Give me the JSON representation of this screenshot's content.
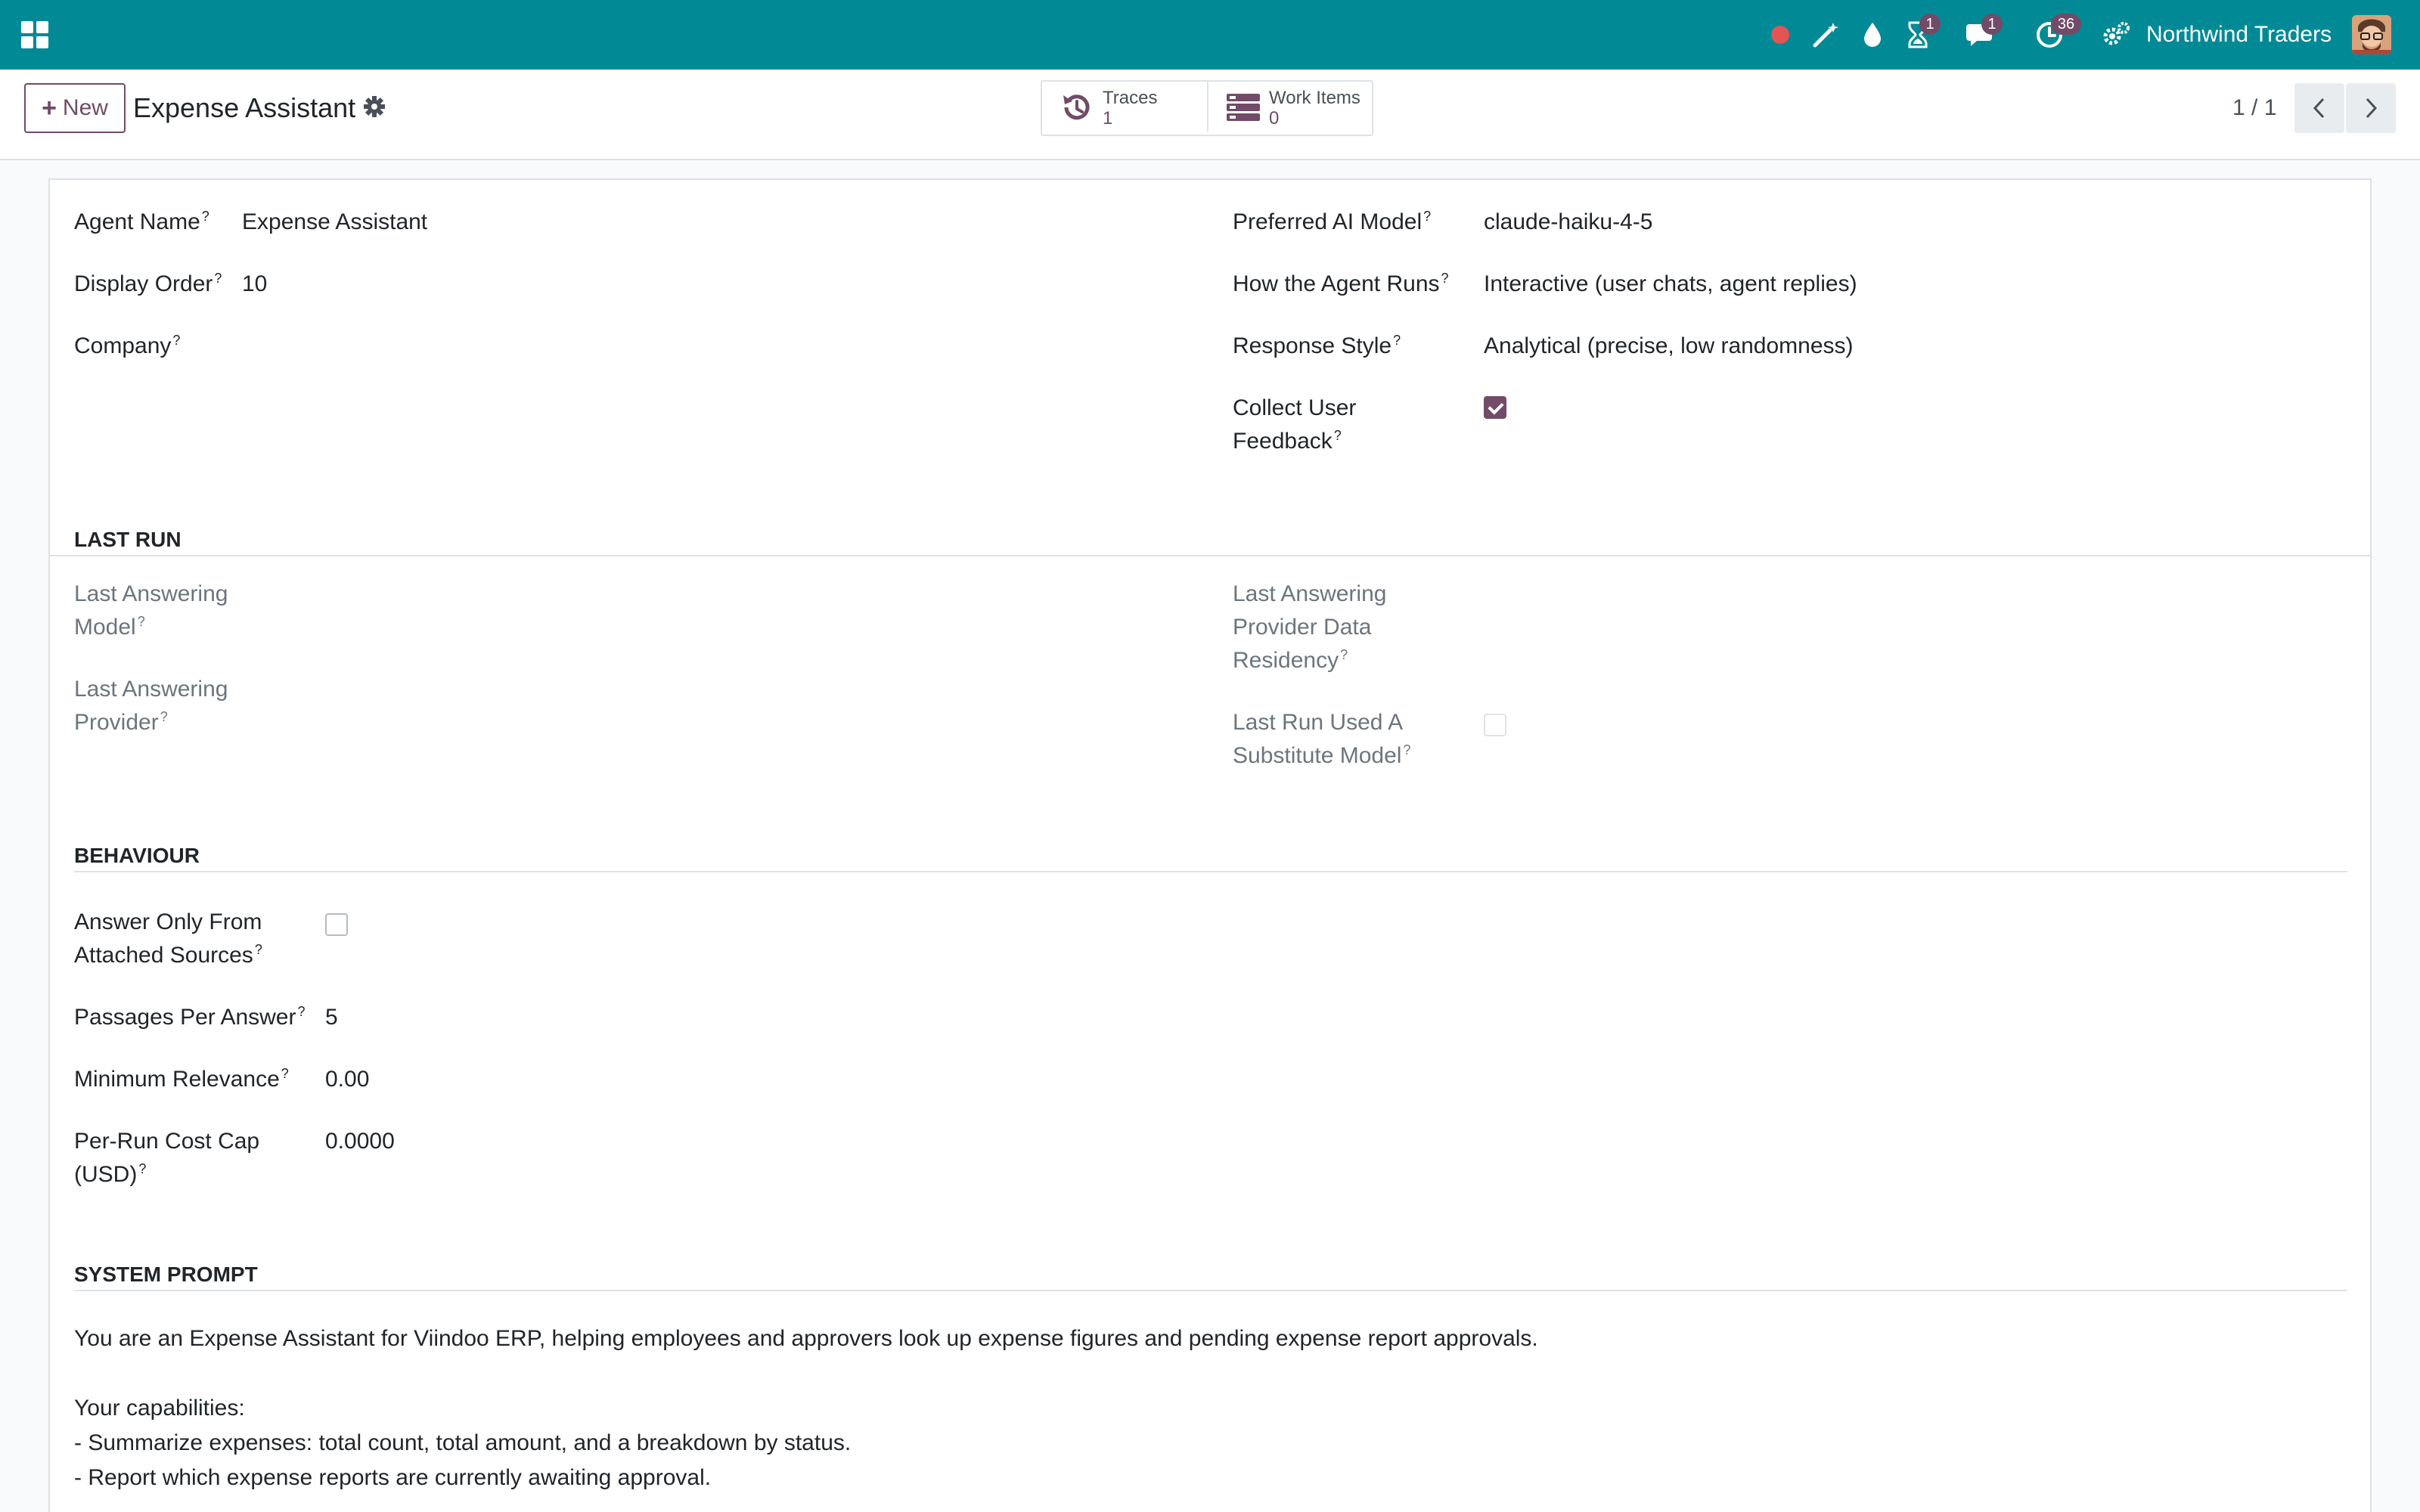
{
  "topbar": {
    "company": "Northwind Traders",
    "badges": {
      "activity": "1",
      "messages": "1",
      "timesheet": "36"
    },
    "colors": {
      "bar": "#018a96",
      "brand": "#714b67",
      "recording": "#e35454"
    },
    "icons": [
      "apps-grid-icon",
      "recording-dot-icon",
      "magic-wand-icon",
      "water-drop-icon",
      "hourglass-icon",
      "chat-icon",
      "clock-icon",
      "settings-gears-icon",
      "user-avatar"
    ]
  },
  "controls": {
    "new_label": "New",
    "record_title": "Expense Assistant",
    "smart_buttons": [
      {
        "label": "Traces",
        "value": "1"
      },
      {
        "label": "Work Items",
        "value": "0"
      }
    ],
    "pager": "1 / 1"
  },
  "form": {
    "agent_name": {
      "label": "Agent Name",
      "value": "Expense Assistant"
    },
    "display_order": {
      "label": "Display Order",
      "value": "10"
    },
    "company": {
      "label": "Company",
      "value": ""
    },
    "preferred_model": {
      "label": "Preferred AI Model",
      "value": "claude-haiku-4-5"
    },
    "how_runs": {
      "label": "How the Agent Runs",
      "value": "Interactive (user chats, agent replies)"
    },
    "response_style": {
      "label": "Response Style",
      "value": "Analytical (precise, low randomness)"
    },
    "collect_feedback": {
      "label_line1": "Collect User",
      "label_line2": "Feedback",
      "checked": true
    }
  },
  "last_run": {
    "title": "LAST RUN",
    "answering_model": {
      "line1": "Last Answering",
      "line2": "Model"
    },
    "answering_provider": {
      "line1": "Last Answering",
      "line2": "Provider"
    },
    "provider_residency": {
      "line1": "Last Answering",
      "line2": "Provider Data",
      "line3": "Residency"
    },
    "substitute_model": {
      "line1": "Last Run Used A",
      "line2": "Substitute Model",
      "checked": false
    }
  },
  "behaviour": {
    "title": "BEHAVIOUR",
    "answer_only": {
      "line1": "Answer Only From",
      "line2": "Attached Sources",
      "checked": false
    },
    "passages": {
      "label": "Passages Per Answer",
      "value": "5"
    },
    "min_relevance": {
      "label": "Minimum Relevance",
      "value": "0.00"
    },
    "cost_cap": {
      "line1": "Per-Run Cost Cap",
      "line2": "(USD)",
      "value": "0.0000"
    }
  },
  "system_prompt": {
    "title": "SYSTEM PROMPT",
    "text": "You are an Expense Assistant for Viindoo ERP, helping employees and approvers look up expense figures and pending expense report approvals.\n\nYour capabilities:\n- Summarize expenses: total count, total amount, and a breakdown by status.\n- Report which expense reports are currently awaiting approval."
  },
  "help_mark": "?"
}
